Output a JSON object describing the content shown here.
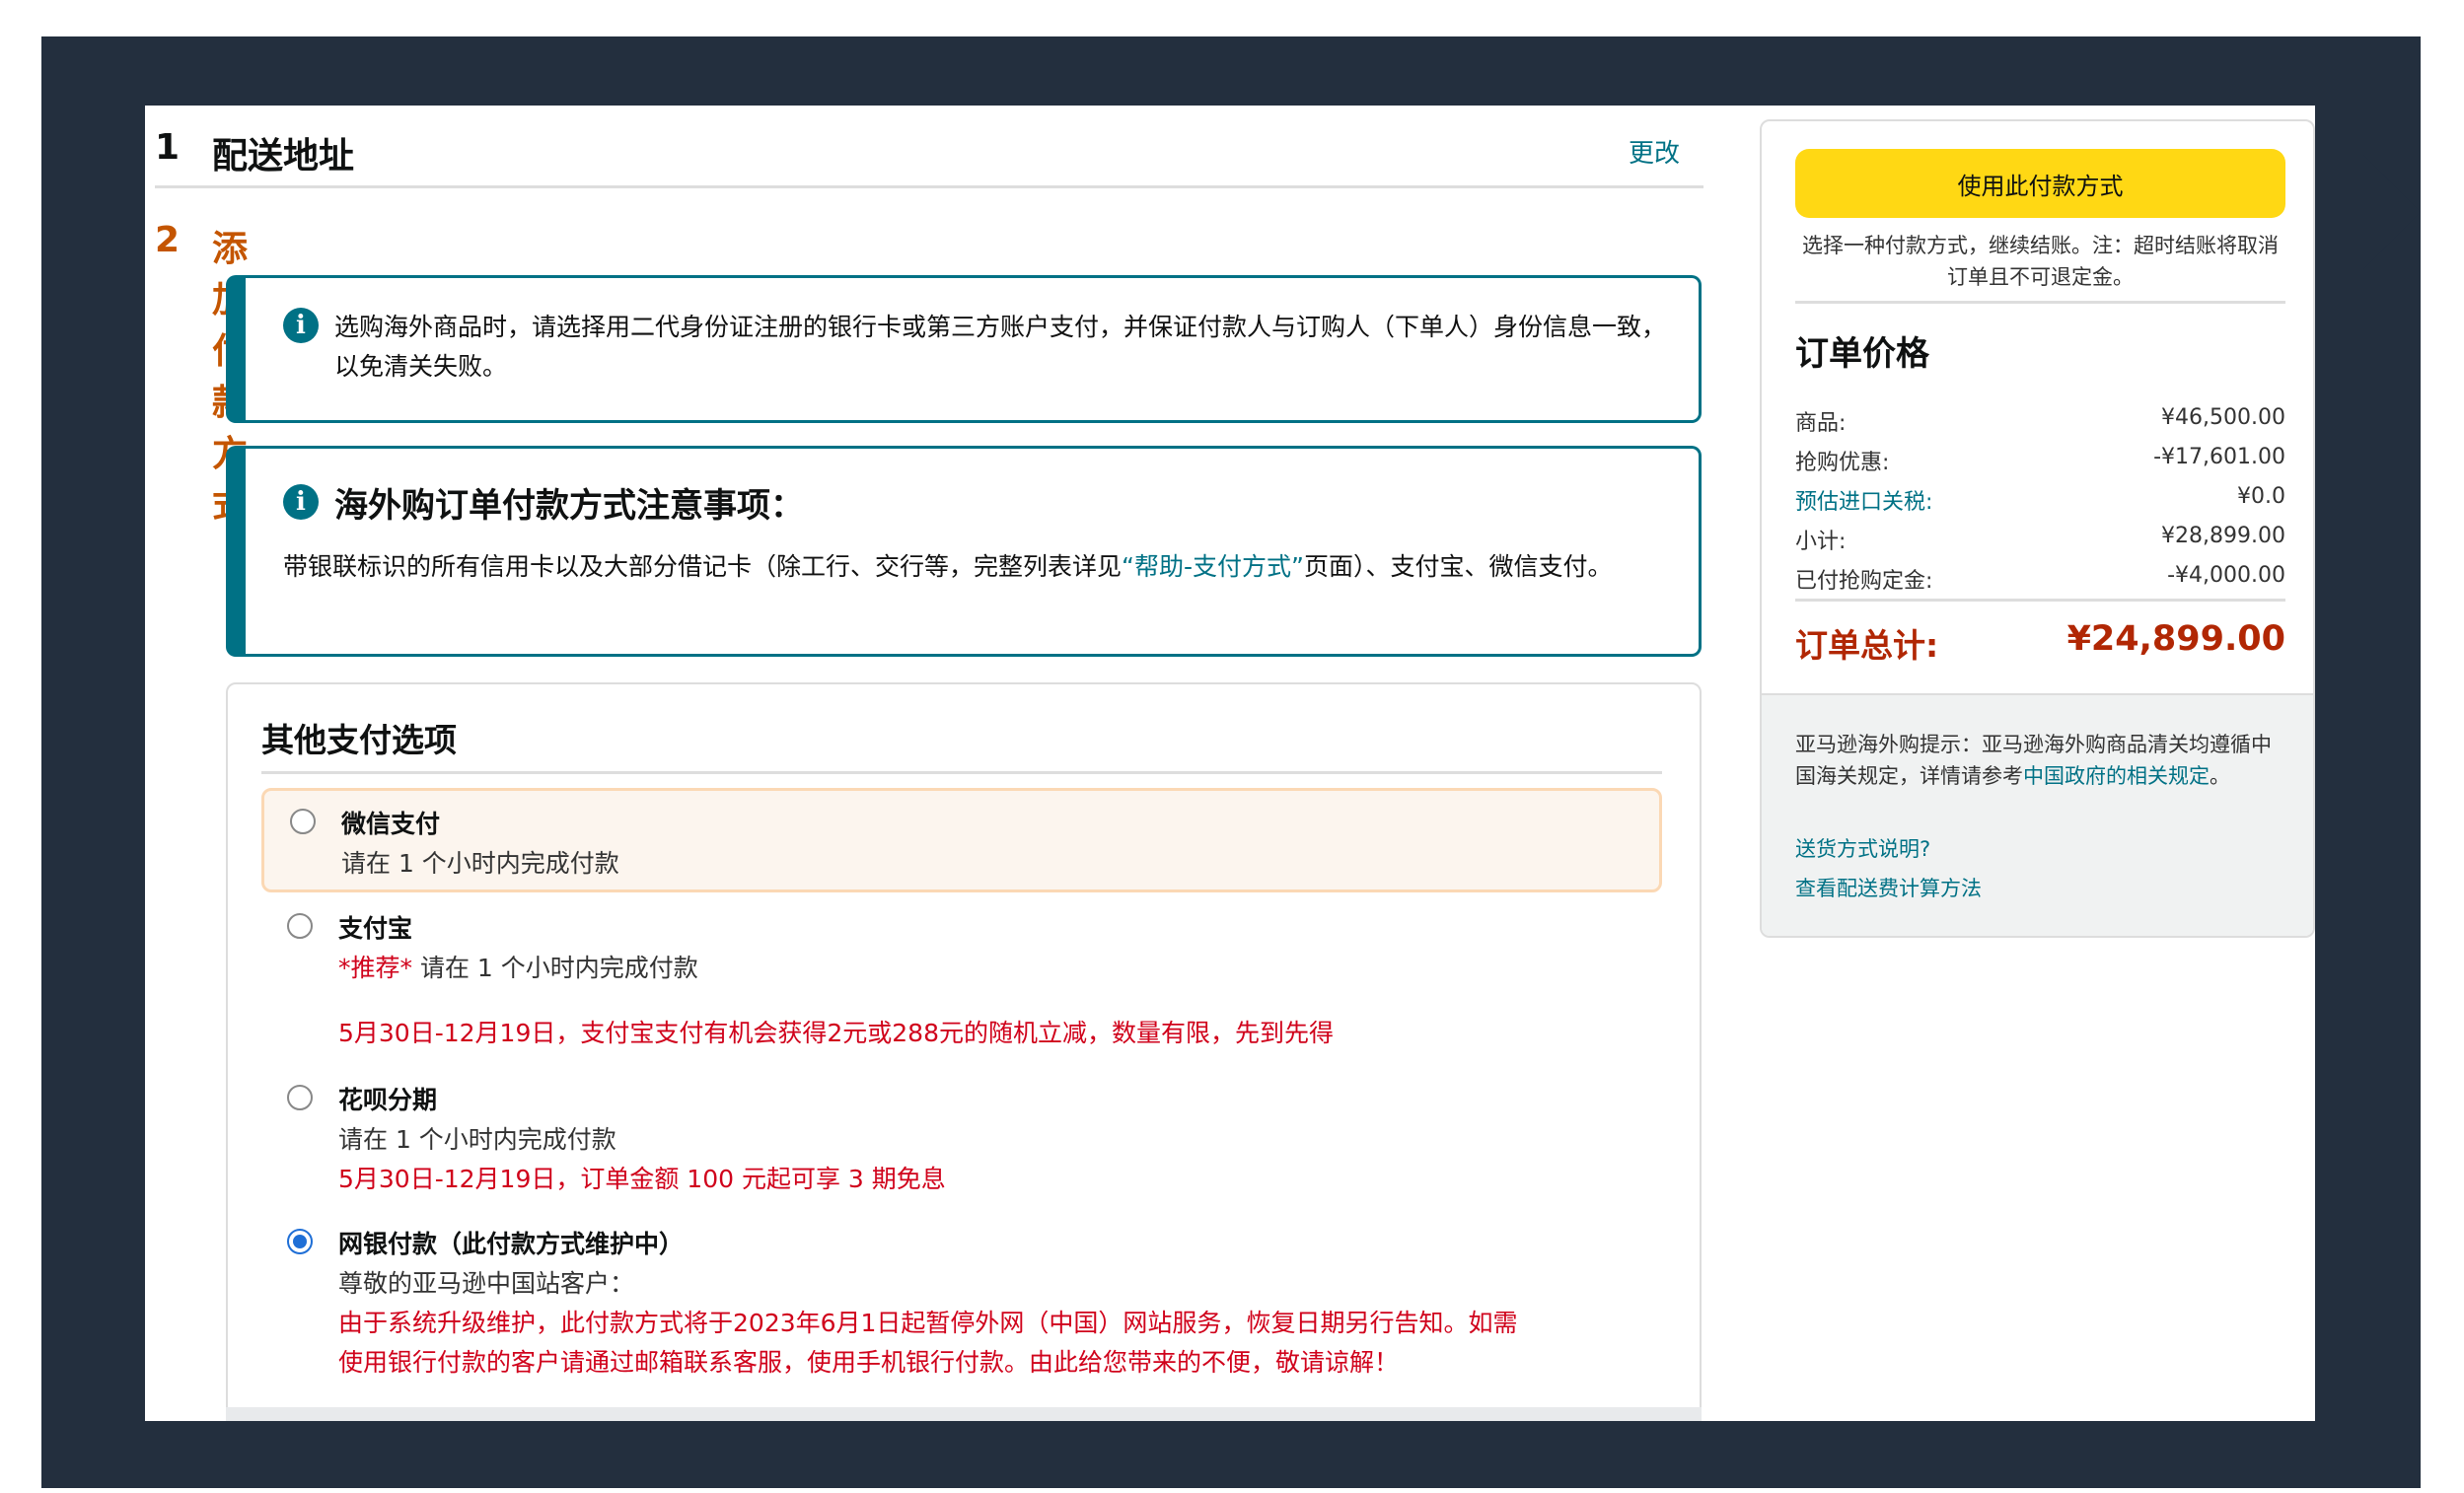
{
  "step1": {
    "num": "1",
    "title": "配送地址",
    "change": "更改"
  },
  "step2": {
    "num": "2",
    "title": "添加付款方式"
  },
  "alert1": {
    "text": "选购海外商品时，请选择用二代身份证注册的银行卡或第三方账户支付，并保证付款人与订购人（下单人）身份信息一致，以免清关失败。"
  },
  "alert2": {
    "heading": "海外购订单付款方式注意事项：",
    "text_before": "带银联标识的所有信用卡以及大部分借记卡（除工行、交行等，完整列表详见",
    "link": "“帮助-支付方式”",
    "text_after": "页面）、支付宝、微信支付。"
  },
  "other": {
    "title": "其他支付选项",
    "wechat": {
      "name": "微信支付",
      "line1": "请在 1 个小时内完成付款"
    },
    "alipay": {
      "name": "支付宝",
      "recommend": "*推荐*",
      "line1": " 请在 1 个小时内完成付款",
      "promo": "5月30日-12月19日，支付宝支付有机会获得2元或288元的随机立减，数量有限，先到先得"
    },
    "huabei": {
      "name": "花呗分期",
      "line1": "请在 1 个小时内完成付款",
      "promo": "5月30日-12月19日，订单金额 100 元起可享 3 期免息"
    },
    "bank": {
      "name": "网银付款（此付款方式维护中）",
      "line1": "尊敬的亚马逊中国站客户：",
      "notice1": "由于系统升级维护，此付款方式将于2023年6月1日起暂停外网（中国）网站服务，恢复日期另行告知。如需",
      "notice2": "使用银行付款的客户请通过邮箱联系客服，使用手机银行付款。由此给您带来的不便，敬请谅解！"
    }
  },
  "summary": {
    "button": "使用此付款方式",
    "note": "选择一种付款方式，继续结账。注：超时结账将取消订单且不可退定金。",
    "title": "订单价格",
    "rows": [
      {
        "label": "商品:",
        "value": "¥46,500.00"
      },
      {
        "label": "抢购优惠:",
        "value": "-¥17,601.00"
      },
      {
        "label": "预估进口关税:",
        "value": "¥0.0"
      },
      {
        "label": "小计:",
        "value": "¥28,899.00"
      },
      {
        "label": "已付抢购定金:",
        "value": "-¥4,000.00"
      }
    ],
    "total_label": "订单总计:",
    "total_value": "¥24,899.00",
    "tips_prefix": "亚马逊海外购提示：亚马逊海外购商品清关均遵循中国海关规定，详情请参考",
    "tips_link": "中国政府的相关规定",
    "tips_suffix": "。",
    "link_shipping": "送货方式说明?",
    "link_fee": "查看配送费计算方法"
  },
  "colors": {
    "accent": "#007185",
    "step_active": "#c45500",
    "button": "#ffd814",
    "total": "#b12704",
    "alert_red": "#d0021b"
  }
}
